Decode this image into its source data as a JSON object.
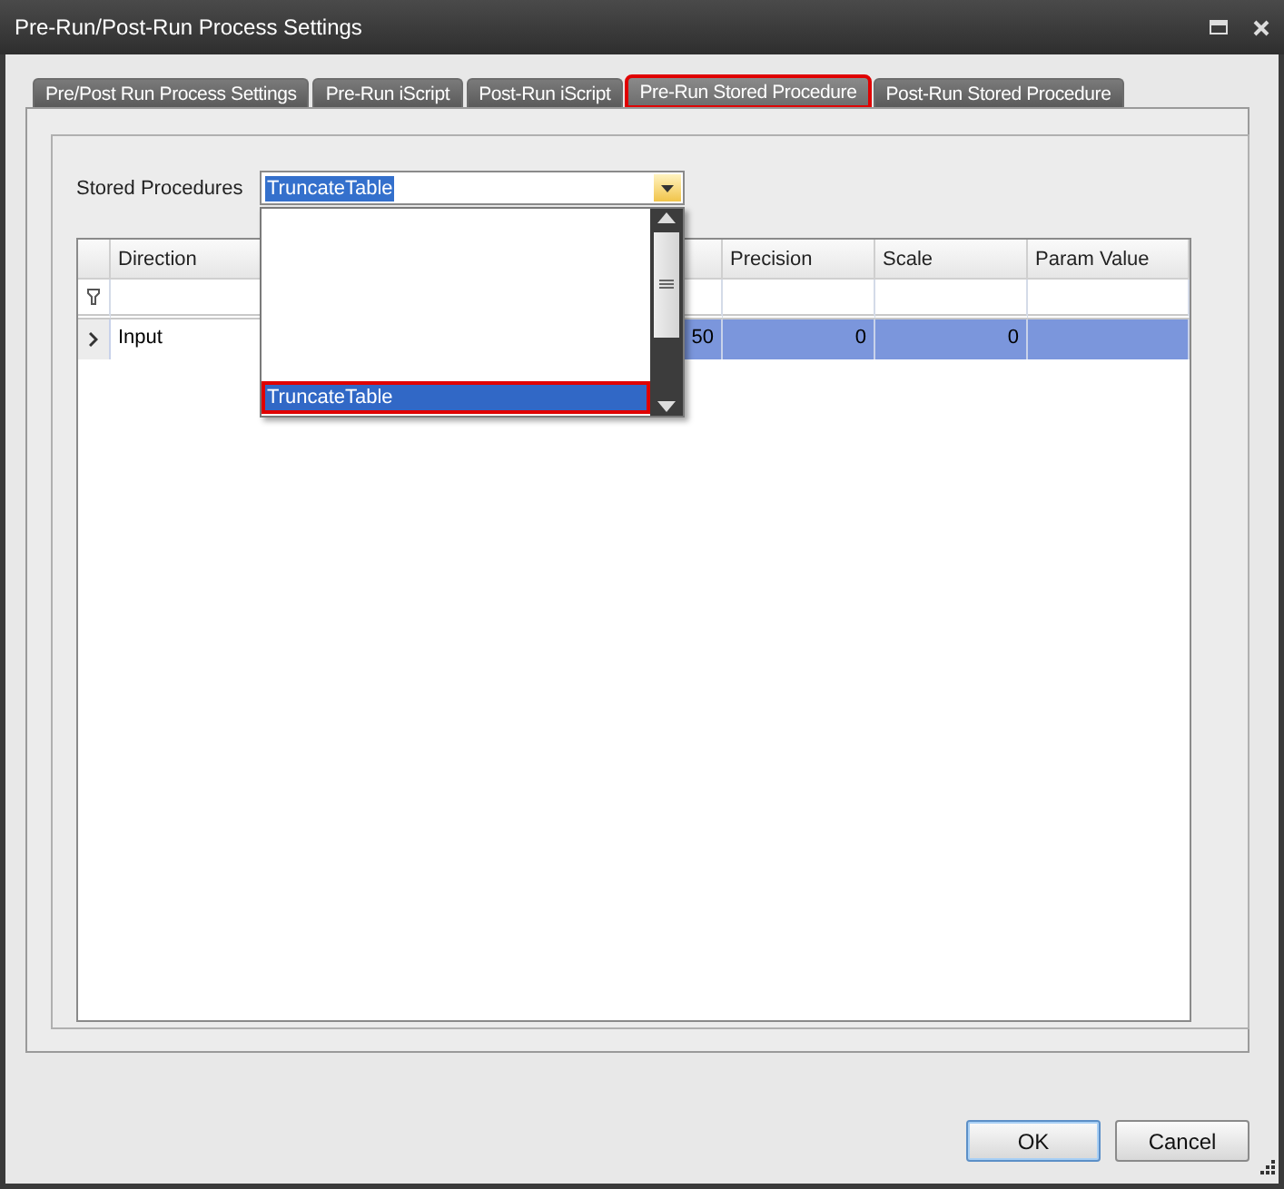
{
  "window": {
    "title": "Pre-Run/Post-Run Process Settings"
  },
  "tabs": [
    {
      "label": "Pre/Post Run Process Settings",
      "selected": false,
      "highlighted": false
    },
    {
      "label": "Pre-Run iScript",
      "selected": false,
      "highlighted": false
    },
    {
      "label": "Post-Run iScript",
      "selected": false,
      "highlighted": false
    },
    {
      "label": "Pre-Run Stored Procedure",
      "selected": true,
      "highlighted": true
    },
    {
      "label": "Post-Run Stored Procedure",
      "selected": false,
      "highlighted": false
    }
  ],
  "stored_procedures": {
    "label": "Stored Procedures",
    "value": "TruncateTable",
    "expanded": true,
    "items": [
      {
        "label": "TruncateTable",
        "selected": true,
        "highlighted": true
      }
    ]
  },
  "grid": {
    "columns": [
      {
        "label": "Direction"
      },
      {},
      {
        "label": "Precision"
      },
      {
        "label": "Scale"
      },
      {
        "label": "Param Value"
      }
    ],
    "rows": [
      {
        "selected": true,
        "cells": [
          "Input",
          "50",
          "0",
          "0",
          ""
        ]
      }
    ]
  },
  "buttons": [
    {
      "label": "OK",
      "default": true
    },
    {
      "label": "Cancel",
      "default": false
    }
  ]
}
